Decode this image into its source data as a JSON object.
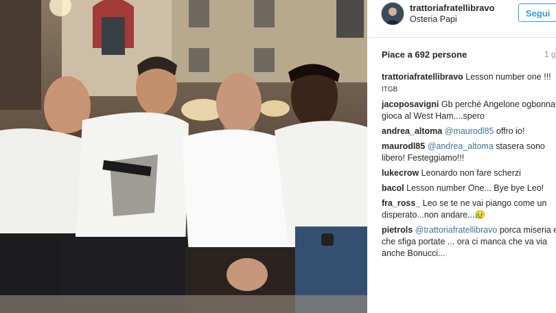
{
  "photo": {
    "alt": "group photo"
  },
  "header": {
    "username": "trattoriafratellibravo",
    "location": "Osteria Papi",
    "follow_label": "Segui"
  },
  "likes_text": "Piace a 692 persone",
  "time_text": "1 g",
  "comments": [
    {
      "user": "trattoriafratellibravo",
      "text": "Lesson number one !!!",
      "extra": "ITGB"
    },
    {
      "user": "jacoposavigni",
      "text": "Gb perché Angelone ogbonna gioca al West Ham....spero"
    },
    {
      "user": "andrea_altoma",
      "mention": "@maurodl85",
      "text": "offro io!"
    },
    {
      "user": "maurodl85",
      "mention": "@andrea_altoma",
      "text": "stasera sono libero! Festeggiamo!!!"
    },
    {
      "user": "lukecrow",
      "text": "Leonardo non fare scherzi"
    },
    {
      "user": "bacol",
      "text": "Lesson number One... Bye bye Leo!"
    },
    {
      "user": "fra_ross_",
      "text": "Leo se te ne vai piango come un disperato...non andare...😥"
    },
    {
      "user": "pietrols",
      "mention": "@trattoriafratellibravo",
      "text": "porca miseria e che sfiga portate ... ora ci manca che va via anche Bonucci..."
    }
  ]
}
